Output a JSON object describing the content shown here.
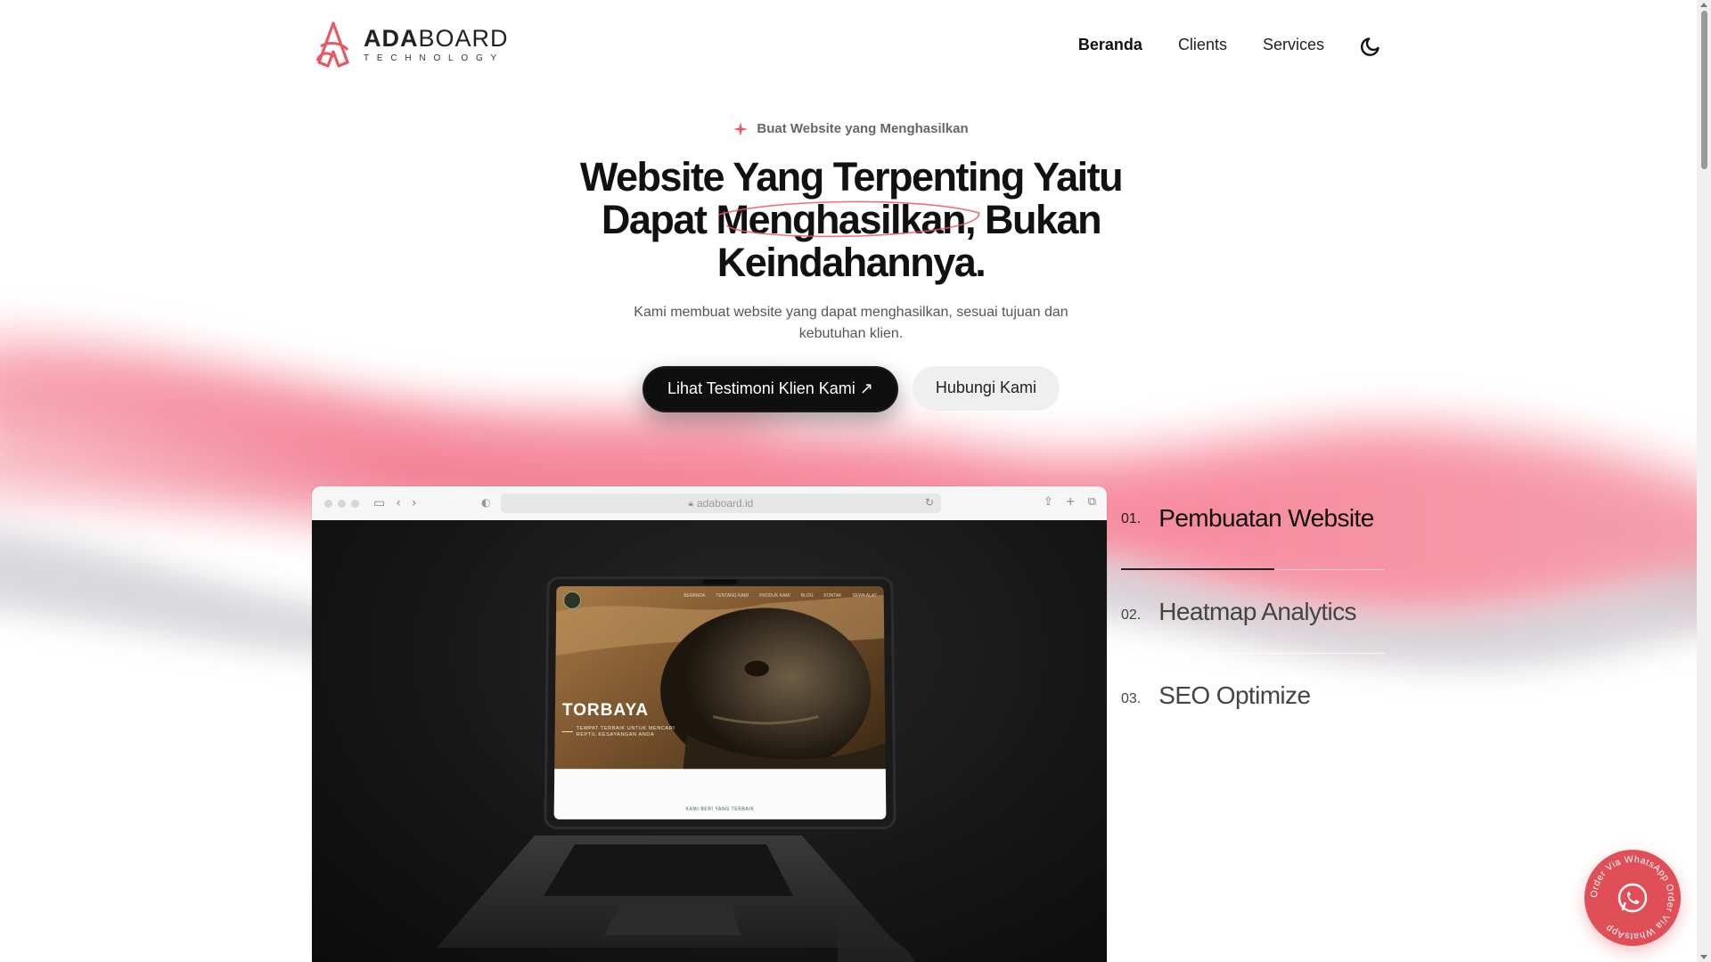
{
  "header": {
    "logo_bold": "ADA",
    "logo_rest": "BOARD",
    "logo_tagline": "TECHNOLOGY",
    "nav": [
      {
        "label": "Beranda",
        "active": true
      },
      {
        "label": "Clients",
        "active": false
      },
      {
        "label": "Services",
        "active": false
      }
    ],
    "theme_toggle_icon": "moon-icon"
  },
  "hero": {
    "eyebrow": "Buat Website yang Menghasilkan",
    "headline_part1": "Website Yang Terpenting Yaitu Dapat",
    "headline_highlight": "Menghasilkan,",
    "headline_part2": "Bukan Keindahannya.",
    "subtitle": "Kami membuat website yang dapat menghasilkan, sesuai tujuan dan kebutuhan klien.",
    "primary_cta": "Lihat Testimoni Klien Kami ↗",
    "secondary_cta": "Hubungi Kami"
  },
  "browser": {
    "url": "adaboard.id",
    "laptop_site": {
      "title": "TORBAYA",
      "tagline": "TEMPAT TERBAIK UNTUK MENCARI REPTIL KESAYANGAN ANDA",
      "footer_text": "KAMI BERI YANG TERBAIK",
      "nav": [
        "BERANDA",
        "TENTANG KAMI",
        "PRODUK KAMI",
        "BLOG",
        "KONTAK",
        "SEWA ALAT"
      ]
    }
  },
  "services": [
    {
      "num": "01.",
      "label": "Pembuatan Website",
      "active": true,
      "progress": 0.58
    },
    {
      "num": "02.",
      "label": "Heatmap Analytics",
      "active": false
    },
    {
      "num": "03.",
      "label": "SEO Optimize",
      "active": false
    }
  ],
  "whatsapp": {
    "ring_text": "Order Via WhatsApp Order Via WhatsApp"
  },
  "colors": {
    "accent": "#e04e57",
    "wave_pink": "#f26a82",
    "dark_button": "#0f0f10"
  }
}
